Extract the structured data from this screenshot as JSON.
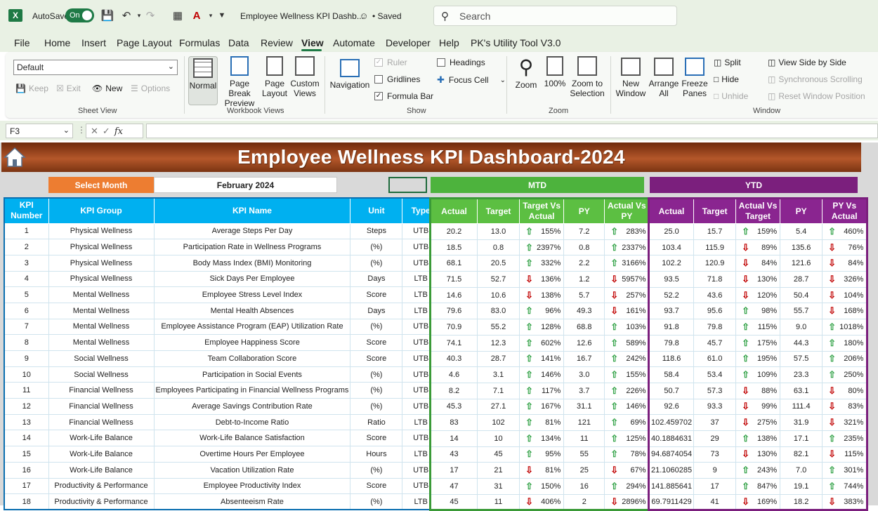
{
  "titlebar": {
    "autosave_label": "AutoSave",
    "autosave_state": "On",
    "doc_title": "Employee Wellness KPI Dashb...",
    "saved_status": "• Saved",
    "search_placeholder": "Search"
  },
  "menu": [
    "File",
    "Home",
    "Insert",
    "Page Layout",
    "Formulas",
    "Data",
    "Review",
    "View",
    "Automate",
    "Developer",
    "Help",
    "PK's Utility Tool V3.0"
  ],
  "menu_active": "View",
  "ribbon": {
    "sheet_view": {
      "label": "Sheet View",
      "dropdown_value": "Default",
      "keep": "Keep",
      "exit": "Exit",
      "new": "New",
      "options": "Options"
    },
    "workbook_views": {
      "label": "Workbook Views",
      "normal": "Normal",
      "page_break_1": "Page Break",
      "page_break_2": "Preview",
      "page_layout_1": "Page",
      "page_layout_2": "Layout",
      "custom_1": "Custom",
      "custom_2": "Views"
    },
    "show": {
      "label": "Show",
      "navigation": "Navigation",
      "ruler": "Ruler",
      "gridlines": "Gridlines",
      "formula_bar": "Formula Bar",
      "headings": "Headings",
      "focus_cell": "Focus Cell"
    },
    "zoom": {
      "label": "Zoom",
      "zoom": "Zoom",
      "hundred": "100%",
      "zoom_sel_1": "Zoom to",
      "zoom_sel_2": "Selection"
    },
    "window": {
      "label": "Window",
      "new_window_1": "New",
      "new_window_2": "Window",
      "arrange_1": "Arrange",
      "arrange_2": "All",
      "freeze_1": "Freeze",
      "freeze_2": "Panes",
      "split": "Split",
      "hide": "Hide",
      "unhide": "Unhide",
      "side_by_side": "View Side by Side",
      "sync_scroll": "Synchronous Scrolling",
      "reset_pos": "Reset Window Position"
    }
  },
  "formula_bar": {
    "name_box": "F3"
  },
  "dashboard": {
    "title": "Employee Wellness KPI Dashboard-2024",
    "select_month_label": "Select Month",
    "select_month_value": "February 2024",
    "mtd_label": "MTD",
    "ytd_label": "YTD",
    "left_headers": [
      "KPI Number",
      "KPI Group",
      "KPI Name",
      "Unit",
      "Type"
    ],
    "mtd_headers": [
      "Actual",
      "Target",
      "Target Vs Actual",
      "PY",
      "Actual Vs PY"
    ],
    "ytd_headers": [
      "Actual",
      "Target",
      "Actual Vs Target",
      "PY",
      "PY Vs Actual"
    ],
    "rows": [
      {
        "num": "1",
        "group": "Physical Wellness",
        "name": "Average Steps Per Day",
        "unit": "Steps",
        "type": "UTB",
        "m_actual": "20.2",
        "m_target": "13.0",
        "m_tva_dir": "up",
        "m_tva": "155%",
        "m_py": "7.2",
        "m_avp_dir": "up",
        "m_avp": "283%",
        "y_actual": "25.0",
        "y_target": "15.7",
        "y_avt_dir": "up",
        "y_avt": "159%",
        "y_py": "5.4",
        "y_pva_dir": "up",
        "y_pva": "460%"
      },
      {
        "num": "2",
        "group": "Physical Wellness",
        "name": "Participation Rate in Wellness Programs",
        "unit": "(%)",
        "type": "UTB",
        "m_actual": "18.5",
        "m_target": "0.8",
        "m_tva_dir": "up",
        "m_tva": "2397%",
        "m_py": "0.8",
        "m_avp_dir": "up",
        "m_avp": "2337%",
        "y_actual": "103.4",
        "y_target": "115.9",
        "y_avt_dir": "down",
        "y_avt": "89%",
        "y_py": "135.6",
        "y_pva_dir": "down",
        "y_pva": "76%"
      },
      {
        "num": "3",
        "group": "Physical Wellness",
        "name": "Body Mass Index (BMI) Monitoring",
        "unit": "(%)",
        "type": "UTB",
        "m_actual": "68.1",
        "m_target": "20.5",
        "m_tva_dir": "up",
        "m_tva": "332%",
        "m_py": "2.2",
        "m_avp_dir": "up",
        "m_avp": "3166%",
        "y_actual": "102.2",
        "y_target": "120.9",
        "y_avt_dir": "down",
        "y_avt": "84%",
        "y_py": "121.6",
        "y_pva_dir": "down",
        "y_pva": "84%"
      },
      {
        "num": "4",
        "group": "Physical Wellness",
        "name": "Sick Days Per Employee",
        "unit": "Days",
        "type": "LTB",
        "m_actual": "71.5",
        "m_target": "52.7",
        "m_tva_dir": "down",
        "m_tva": "136%",
        "m_py": "1.2",
        "m_avp_dir": "down",
        "m_avp": "5957%",
        "y_actual": "93.5",
        "y_target": "71.8",
        "y_avt_dir": "down",
        "y_avt": "130%",
        "y_py": "28.7",
        "y_pva_dir": "down",
        "y_pva": "326%"
      },
      {
        "num": "5",
        "group": "Mental Wellness",
        "name": "Employee Stress Level Index",
        "unit": "Score",
        "type": "LTB",
        "m_actual": "14.6",
        "m_target": "10.6",
        "m_tva_dir": "down",
        "m_tva": "138%",
        "m_py": "5.7",
        "m_avp_dir": "down",
        "m_avp": "257%",
        "y_actual": "52.2",
        "y_target": "43.6",
        "y_avt_dir": "down",
        "y_avt": "120%",
        "y_py": "50.4",
        "y_pva_dir": "down",
        "y_pva": "104%"
      },
      {
        "num": "6",
        "group": "Mental Wellness",
        "name": "Mental Health Absences",
        "unit": "Days",
        "type": "LTB",
        "m_actual": "79.6",
        "m_target": "83.0",
        "m_tva_dir": "up",
        "m_tva": "96%",
        "m_py": "49.3",
        "m_avp_dir": "down",
        "m_avp": "161%",
        "y_actual": "93.7",
        "y_target": "95.6",
        "y_avt_dir": "up",
        "y_avt": "98%",
        "y_py": "55.7",
        "y_pva_dir": "down",
        "y_pva": "168%"
      },
      {
        "num": "7",
        "group": "Mental Wellness",
        "name": "Employee Assistance Program (EAP) Utilization Rate",
        "unit": "(%)",
        "type": "UTB",
        "m_actual": "70.9",
        "m_target": "55.2",
        "m_tva_dir": "up",
        "m_tva": "128%",
        "m_py": "68.8",
        "m_avp_dir": "up",
        "m_avp": "103%",
        "y_actual": "91.8",
        "y_target": "79.8",
        "y_avt_dir": "up",
        "y_avt": "115%",
        "y_py": "9.0",
        "y_pva_dir": "up",
        "y_pva": "1018%"
      },
      {
        "num": "8",
        "group": "Mental Wellness",
        "name": "Employee Happiness Score",
        "unit": "Score",
        "type": "UTB",
        "m_actual": "74.1",
        "m_target": "12.3",
        "m_tva_dir": "up",
        "m_tva": "602%",
        "m_py": "12.6",
        "m_avp_dir": "up",
        "m_avp": "589%",
        "y_actual": "79.8",
        "y_target": "45.7",
        "y_avt_dir": "up",
        "y_avt": "175%",
        "y_py": "44.3",
        "y_pva_dir": "up",
        "y_pva": "180%"
      },
      {
        "num": "9",
        "group": "Social Wellness",
        "name": "Team Collaboration Score",
        "unit": "Score",
        "type": "UTB",
        "m_actual": "40.3",
        "m_target": "28.7",
        "m_tva_dir": "up",
        "m_tva": "141%",
        "m_py": "16.7",
        "m_avp_dir": "up",
        "m_avp": "242%",
        "y_actual": "118.6",
        "y_target": "61.0",
        "y_avt_dir": "up",
        "y_avt": "195%",
        "y_py": "57.5",
        "y_pva_dir": "up",
        "y_pva": "206%"
      },
      {
        "num": "10",
        "group": "Social Wellness",
        "name": "Participation in Social Events",
        "unit": "(%)",
        "type": "UTB",
        "m_actual": "4.6",
        "m_target": "3.1",
        "m_tva_dir": "up",
        "m_tva": "146%",
        "m_py": "3.0",
        "m_avp_dir": "up",
        "m_avp": "155%",
        "y_actual": "58.4",
        "y_target": "53.4",
        "y_avt_dir": "up",
        "y_avt": "109%",
        "y_py": "23.3",
        "y_pva_dir": "up",
        "y_pva": "250%"
      },
      {
        "num": "11",
        "group": "Financial Wellness",
        "name": "Employees Participating in Financial Wellness Programs",
        "unit": "(%)",
        "type": "UTB",
        "m_actual": "8.2",
        "m_target": "7.1",
        "m_tva_dir": "up",
        "m_tva": "117%",
        "m_py": "3.7",
        "m_avp_dir": "up",
        "m_avp": "226%",
        "y_actual": "50.7",
        "y_target": "57.3",
        "y_avt_dir": "down",
        "y_avt": "88%",
        "y_py": "63.1",
        "y_pva_dir": "down",
        "y_pva": "80%"
      },
      {
        "num": "12",
        "group": "Financial Wellness",
        "name": "Average Savings Contribution Rate",
        "unit": "(%)",
        "type": "UTB",
        "m_actual": "45.3",
        "m_target": "27.1",
        "m_tva_dir": "up",
        "m_tva": "167%",
        "m_py": "31.1",
        "m_avp_dir": "up",
        "m_avp": "146%",
        "y_actual": "92.6",
        "y_target": "93.3",
        "y_avt_dir": "down",
        "y_avt": "99%",
        "y_py": "111.4",
        "y_pva_dir": "down",
        "y_pva": "83%"
      },
      {
        "num": "13",
        "group": "Financial Wellness",
        "name": "Debt-to-Income Ratio",
        "unit": "Ratio",
        "type": "LTB",
        "m_actual": "83",
        "m_target": "102",
        "m_tva_dir": "up",
        "m_tva": "81%",
        "m_py": "121",
        "m_avp_dir": "up",
        "m_avp": "69%",
        "y_actual": "102.459702",
        "y_target": "37",
        "y_avt_dir": "down",
        "y_avt": "275%",
        "y_py": "31.9",
        "y_pva_dir": "down",
        "y_pva": "321%"
      },
      {
        "num": "14",
        "group": "Work-Life Balance",
        "name": "Work-Life Balance Satisfaction",
        "unit": "Score",
        "type": "UTB",
        "m_actual": "14",
        "m_target": "10",
        "m_tva_dir": "up",
        "m_tva": "134%",
        "m_py": "11",
        "m_avp_dir": "up",
        "m_avp": "125%",
        "y_actual": "40.1884631",
        "y_target": "29",
        "y_avt_dir": "up",
        "y_avt": "138%",
        "y_py": "17.1",
        "y_pva_dir": "up",
        "y_pva": "235%"
      },
      {
        "num": "15",
        "group": "Work-Life Balance",
        "name": "Overtime Hours Per Employee",
        "unit": "Hours",
        "type": "LTB",
        "m_actual": "43",
        "m_target": "45",
        "m_tva_dir": "up",
        "m_tva": "95%",
        "m_py": "55",
        "m_avp_dir": "up",
        "m_avp": "78%",
        "y_actual": "94.6874054",
        "y_target": "73",
        "y_avt_dir": "down",
        "y_avt": "130%",
        "y_py": "82.1",
        "y_pva_dir": "down",
        "y_pva": "115%"
      },
      {
        "num": "16",
        "group": "Work-Life Balance",
        "name": "Vacation Utilization Rate",
        "unit": "(%)",
        "type": "UTB",
        "m_actual": "17",
        "m_target": "21",
        "m_tva_dir": "down",
        "m_tva": "81%",
        "m_py": "25",
        "m_avp_dir": "down",
        "m_avp": "67%",
        "y_actual": "21.1060285",
        "y_target": "9",
        "y_avt_dir": "up",
        "y_avt": "243%",
        "y_py": "7.0",
        "y_pva_dir": "up",
        "y_pva": "301%"
      },
      {
        "num": "17",
        "group": "Productivity & Performance",
        "name": "Employee Productivity Index",
        "unit": "Score",
        "type": "UTB",
        "m_actual": "47",
        "m_target": "31",
        "m_tva_dir": "up",
        "m_tva": "150%",
        "m_py": "16",
        "m_avp_dir": "up",
        "m_avp": "294%",
        "y_actual": "141.885641",
        "y_target": "17",
        "y_avt_dir": "up",
        "y_avt": "847%",
        "y_py": "19.1",
        "y_pva_dir": "up",
        "y_pva": "744%"
      },
      {
        "num": "18",
        "group": "Productivity & Performance",
        "name": "Absenteeism Rate",
        "unit": "(%)",
        "type": "LTB",
        "m_actual": "45",
        "m_target": "11",
        "m_tva_dir": "down",
        "m_tva": "406%",
        "m_py": "2",
        "m_avp_dir": "down",
        "m_avp": "2896%",
        "y_actual": "69.7911429",
        "y_target": "41",
        "y_avt_dir": "down",
        "y_avt": "169%",
        "y_py": "18.2",
        "y_pva_dir": "down",
        "y_pva": "383%"
      }
    ]
  },
  "colors": {
    "excel_green": "#1e7a46",
    "banner": "#b4572a",
    "select_month": "#ed7d31",
    "left_header": "#00b0f0",
    "mtd_header": "#4db33d",
    "ytd_header": "#7b1f7d",
    "arrow_up": "#2ea043",
    "arrow_down": "#c00000"
  }
}
